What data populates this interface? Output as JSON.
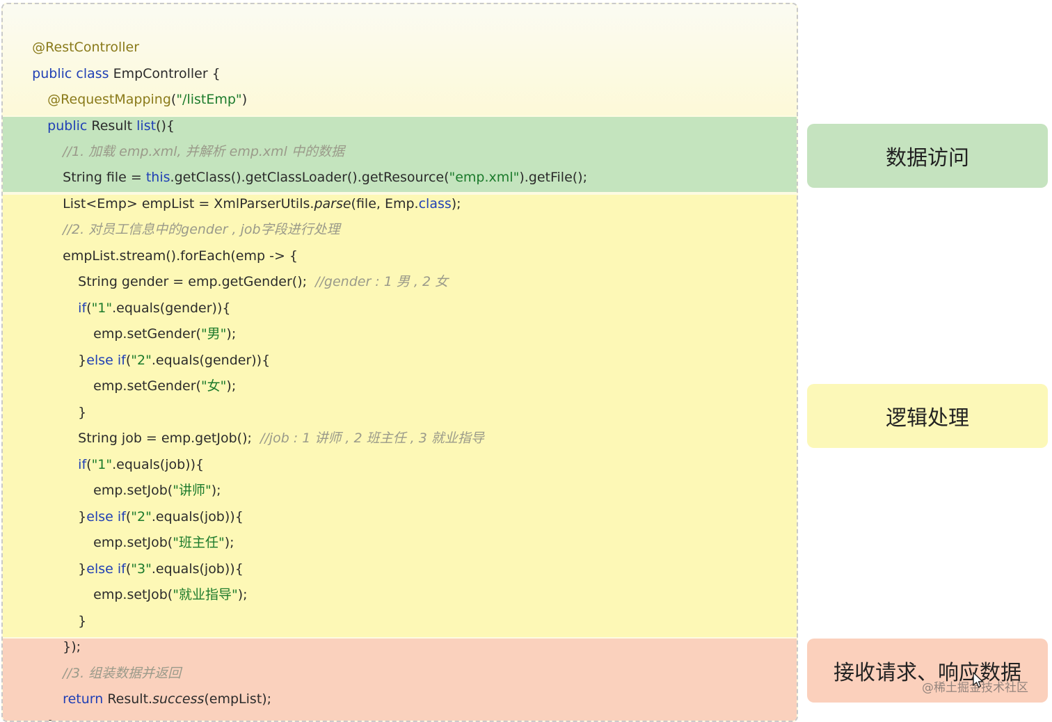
{
  "code": {
    "l1": {
      "ann": "@RestController"
    },
    "l2": {
      "kw1": "public class ",
      "rest": "EmpController {"
    },
    "l3": {
      "ann": "@RequestMapping",
      "p1": "(",
      "str": "\"/listEmp\"",
      "p2": ")"
    },
    "l4": {
      "kw1": "public ",
      "t1": "Result ",
      "kw2": "list",
      "t2": "(){"
    },
    "l5": {
      "cmt": "//1. 加载 emp.xml, 并解析 emp.xml 中的数据"
    },
    "l6": {
      "t1": "String file = ",
      "kw1": "this",
      "t2": ".getClass().getClassLoader().getResource(",
      "str": "\"emp.xml\"",
      "t3": ").getFile();"
    },
    "l7": {
      "t1": "List<Emp> empList = XmlParserUtils.",
      "it": "parse",
      "t2": "(file, Emp.",
      "kw1": "class",
      "t3": ");"
    },
    "l8": {
      "cmt": "//2. 对员工信息中的gender , job字段进行处理"
    },
    "l9": {
      "t1": "empList.stream().forEach(emp -> {"
    },
    "l10": {
      "t1": "String gender = emp.getGender();  ",
      "cmt": "//gender : 1 男 , 2 女"
    },
    "l11": {
      "kw1": "if",
      "t1": "(",
      "str": "\"1\"",
      "t2": ".equals(gender)){"
    },
    "l12": {
      "t1": "emp.setGender(",
      "str": "\"男\"",
      "t2": ");"
    },
    "l13": {
      "t1": "}",
      "kw1": "else if",
      "t2": "(",
      "str": "\"2\"",
      "t3": ".equals(gender)){"
    },
    "l14": {
      "t1": "emp.setGender(",
      "str": "\"女\"",
      "t2": ");"
    },
    "l15": {
      "t1": "}"
    },
    "l16": {
      "t1": "String job = emp.getJob();  ",
      "cmt": "//job : 1 讲师 , 2 班主任 , 3 就业指导"
    },
    "l17": {
      "kw1": "if",
      "t1": "(",
      "str": "\"1\"",
      "t2": ".equals(job)){"
    },
    "l18": {
      "t1": "emp.setJob(",
      "str": "\"讲师\"",
      "t2": ");"
    },
    "l19": {
      "t1": "}",
      "kw1": "else if",
      "t2": "(",
      "str": "\"2\"",
      "t3": ".equals(job)){"
    },
    "l20": {
      "t1": "emp.setJob(",
      "str": "\"班主任\"",
      "t2": ");"
    },
    "l21": {
      "t1": "}",
      "kw1": "else if",
      "t2": "(",
      "str": "\"3\"",
      "t3": ".equals(job)){"
    },
    "l22": {
      "t1": "emp.setJob(",
      "str": "\"就业指导\"",
      "t2": ");"
    },
    "l23": {
      "t1": "}"
    },
    "l24": {
      "t1": "});"
    },
    "l25": {
      "cmt": "//3. 组装数据并返回"
    },
    "l26": {
      "kw1": "return ",
      "t1": "Result.",
      "it": "success",
      "t2": "(empList);"
    },
    "l27": {
      "t1": "}"
    }
  },
  "labels": {
    "data_access": "数据访问",
    "logic": "逻辑处理",
    "request_response": "接收请求、响应数据"
  },
  "watermark": "@稀土掘金技术社区",
  "colors": {
    "green_band": "#c4e4be",
    "yellow_band": "#fdf8b6",
    "red_band": "#fad1bd",
    "keyword": "#1f3fb5",
    "annotation": "#8a7a1a",
    "string": "#1b7a2b",
    "comment": "#9a9a8a"
  }
}
